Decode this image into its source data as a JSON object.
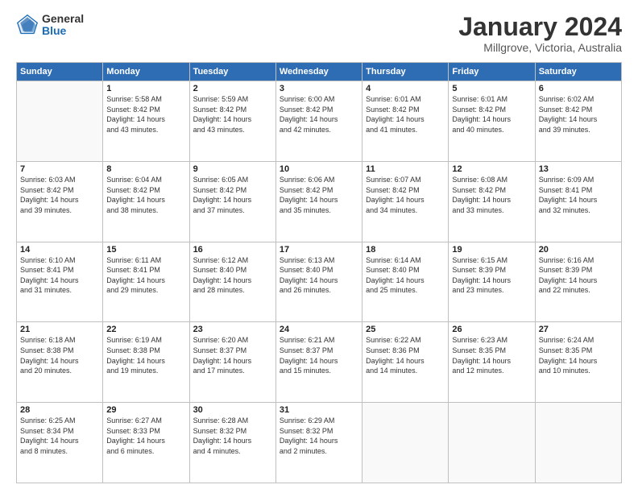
{
  "logo": {
    "general": "General",
    "blue": "Blue"
  },
  "header": {
    "title": "January 2024",
    "subtitle": "Millgrove, Victoria, Australia"
  },
  "days_of_week": [
    "Sunday",
    "Monday",
    "Tuesday",
    "Wednesday",
    "Thursday",
    "Friday",
    "Saturday"
  ],
  "weeks": [
    [
      {
        "day": "",
        "empty": true
      },
      {
        "day": "1",
        "sunrise": "5:58 AM",
        "sunset": "8:42 PM",
        "daylight": "14 hours and 43 minutes."
      },
      {
        "day": "2",
        "sunrise": "5:59 AM",
        "sunset": "8:42 PM",
        "daylight": "14 hours and 43 minutes."
      },
      {
        "day": "3",
        "sunrise": "6:00 AM",
        "sunset": "8:42 PM",
        "daylight": "14 hours and 42 minutes."
      },
      {
        "day": "4",
        "sunrise": "6:01 AM",
        "sunset": "8:42 PM",
        "daylight": "14 hours and 41 minutes."
      },
      {
        "day": "5",
        "sunrise": "6:01 AM",
        "sunset": "8:42 PM",
        "daylight": "14 hours and 40 minutes."
      },
      {
        "day": "6",
        "sunrise": "6:02 AM",
        "sunset": "8:42 PM",
        "daylight": "14 hours and 39 minutes."
      }
    ],
    [
      {
        "day": "7",
        "sunrise": "6:03 AM",
        "sunset": "8:42 PM",
        "daylight": "14 hours and 39 minutes."
      },
      {
        "day": "8",
        "sunrise": "6:04 AM",
        "sunset": "8:42 PM",
        "daylight": "14 hours and 38 minutes."
      },
      {
        "day": "9",
        "sunrise": "6:05 AM",
        "sunset": "8:42 PM",
        "daylight": "14 hours and 37 minutes."
      },
      {
        "day": "10",
        "sunrise": "6:06 AM",
        "sunset": "8:42 PM",
        "daylight": "14 hours and 35 minutes."
      },
      {
        "day": "11",
        "sunrise": "6:07 AM",
        "sunset": "8:42 PM",
        "daylight": "14 hours and 34 minutes."
      },
      {
        "day": "12",
        "sunrise": "6:08 AM",
        "sunset": "8:42 PM",
        "daylight": "14 hours and 33 minutes."
      },
      {
        "day": "13",
        "sunrise": "6:09 AM",
        "sunset": "8:41 PM",
        "daylight": "14 hours and 32 minutes."
      }
    ],
    [
      {
        "day": "14",
        "sunrise": "6:10 AM",
        "sunset": "8:41 PM",
        "daylight": "14 hours and 31 minutes."
      },
      {
        "day": "15",
        "sunrise": "6:11 AM",
        "sunset": "8:41 PM",
        "daylight": "14 hours and 29 minutes."
      },
      {
        "day": "16",
        "sunrise": "6:12 AM",
        "sunset": "8:40 PM",
        "daylight": "14 hours and 28 minutes."
      },
      {
        "day": "17",
        "sunrise": "6:13 AM",
        "sunset": "8:40 PM",
        "daylight": "14 hours and 26 minutes."
      },
      {
        "day": "18",
        "sunrise": "6:14 AM",
        "sunset": "8:40 PM",
        "daylight": "14 hours and 25 minutes."
      },
      {
        "day": "19",
        "sunrise": "6:15 AM",
        "sunset": "8:39 PM",
        "daylight": "14 hours and 23 minutes."
      },
      {
        "day": "20",
        "sunrise": "6:16 AM",
        "sunset": "8:39 PM",
        "daylight": "14 hours and 22 minutes."
      }
    ],
    [
      {
        "day": "21",
        "sunrise": "6:18 AM",
        "sunset": "8:38 PM",
        "daylight": "14 hours and 20 minutes."
      },
      {
        "day": "22",
        "sunrise": "6:19 AM",
        "sunset": "8:38 PM",
        "daylight": "14 hours and 19 minutes."
      },
      {
        "day": "23",
        "sunrise": "6:20 AM",
        "sunset": "8:37 PM",
        "daylight": "14 hours and 17 minutes."
      },
      {
        "day": "24",
        "sunrise": "6:21 AM",
        "sunset": "8:37 PM",
        "daylight": "14 hours and 15 minutes."
      },
      {
        "day": "25",
        "sunrise": "6:22 AM",
        "sunset": "8:36 PM",
        "daylight": "14 hours and 14 minutes."
      },
      {
        "day": "26",
        "sunrise": "6:23 AM",
        "sunset": "8:35 PM",
        "daylight": "14 hours and 12 minutes."
      },
      {
        "day": "27",
        "sunrise": "6:24 AM",
        "sunset": "8:35 PM",
        "daylight": "14 hours and 10 minutes."
      }
    ],
    [
      {
        "day": "28",
        "sunrise": "6:25 AM",
        "sunset": "8:34 PM",
        "daylight": "14 hours and 8 minutes."
      },
      {
        "day": "29",
        "sunrise": "6:27 AM",
        "sunset": "8:33 PM",
        "daylight": "14 hours and 6 minutes."
      },
      {
        "day": "30",
        "sunrise": "6:28 AM",
        "sunset": "8:32 PM",
        "daylight": "14 hours and 4 minutes."
      },
      {
        "day": "31",
        "sunrise": "6:29 AM",
        "sunset": "8:32 PM",
        "daylight": "14 hours and 2 minutes."
      },
      {
        "day": "",
        "empty": true
      },
      {
        "day": "",
        "empty": true
      },
      {
        "day": "",
        "empty": true
      }
    ]
  ],
  "labels": {
    "sunrise": "Sunrise:",
    "sunset": "Sunset:",
    "daylight": "Daylight:"
  }
}
